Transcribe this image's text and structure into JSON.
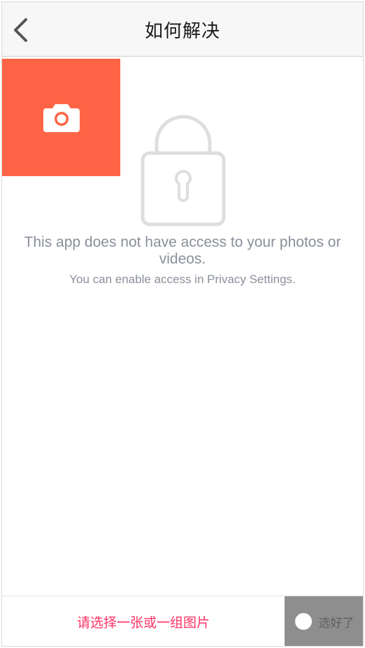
{
  "navbar": {
    "title": "如何解决",
    "back_icon": "chevron-left-icon"
  },
  "camera_tile": {
    "icon": "camera-icon",
    "color": "#ff6446"
  },
  "permission": {
    "lock_icon": "lock-icon",
    "message": "This app does not have access to your photos or videos.",
    "hint": "You can enable access in Privacy Settings."
  },
  "bottom_bar": {
    "hint": "请选择一张或一组图片",
    "hint_color": "#ff3366",
    "done_label": "选好了"
  }
}
